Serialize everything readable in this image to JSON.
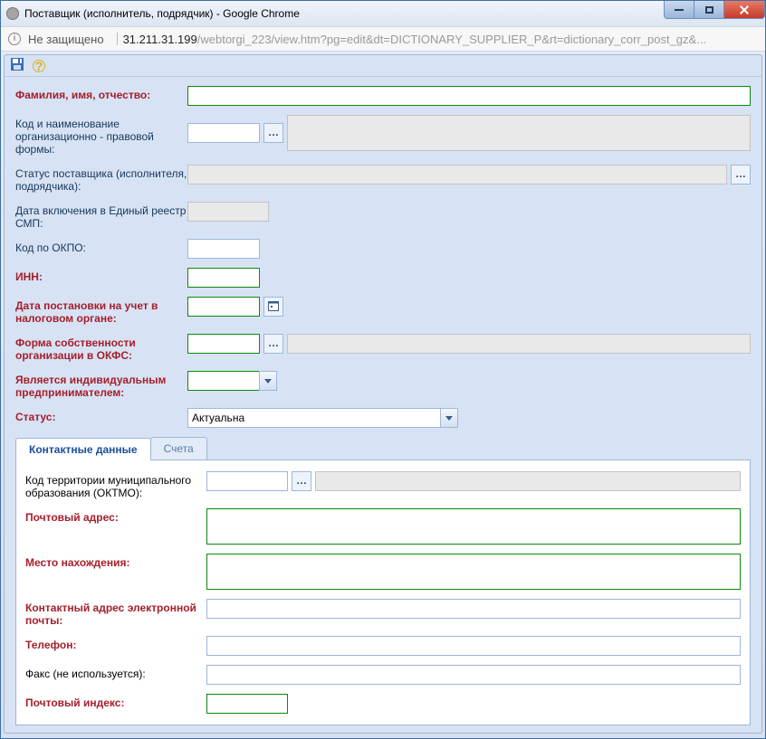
{
  "window": {
    "title": "Поставщик (исполнитель, подрядчик) - Google Chrome"
  },
  "addressbar": {
    "insecure_label": "Не защищено",
    "host": "31.211.31.199",
    "path": "/webtorgi_223/view.htm?pg=edit&dt=DICTIONARY_SUPPLIER_P&rt=dictionary_corr_post_gz&..."
  },
  "form": {
    "full_name_label": "Фамилия, имя, отчество:",
    "full_name_value": "",
    "org_form_label": "Код и наименование организационно - правовой формы:",
    "supplier_status_label": "Статус поставщика (исполнителя, подрядчика):",
    "smp_date_label": "Дата включения в Единый реестр СМП:",
    "okpo_label": "Код по ОКПО:",
    "inn_label": "ИНН:",
    "tax_reg_date_label": "Дата постановки на учет в налоговом органе:",
    "okfs_label": "Форма собственности организации в ОКФС:",
    "is_ie_label": "Является индивидуальным предпринимателем:",
    "status_label": "Статус:",
    "status_value": "Актуальна"
  },
  "tabs": {
    "contact": "Контактные данные",
    "accounts": "Счета"
  },
  "contact": {
    "oktmo_label": "Код территории муниципального образования (ОКТМО):",
    "postal_address_label": "Почтовый адрес:",
    "location_label": "Место нахождения:",
    "email_label": "Контактный адрес электронной почты:",
    "phone_label": "Телефон:",
    "fax_label": "Факс (не используется):",
    "postal_code_label": "Почтовый индекс:"
  }
}
